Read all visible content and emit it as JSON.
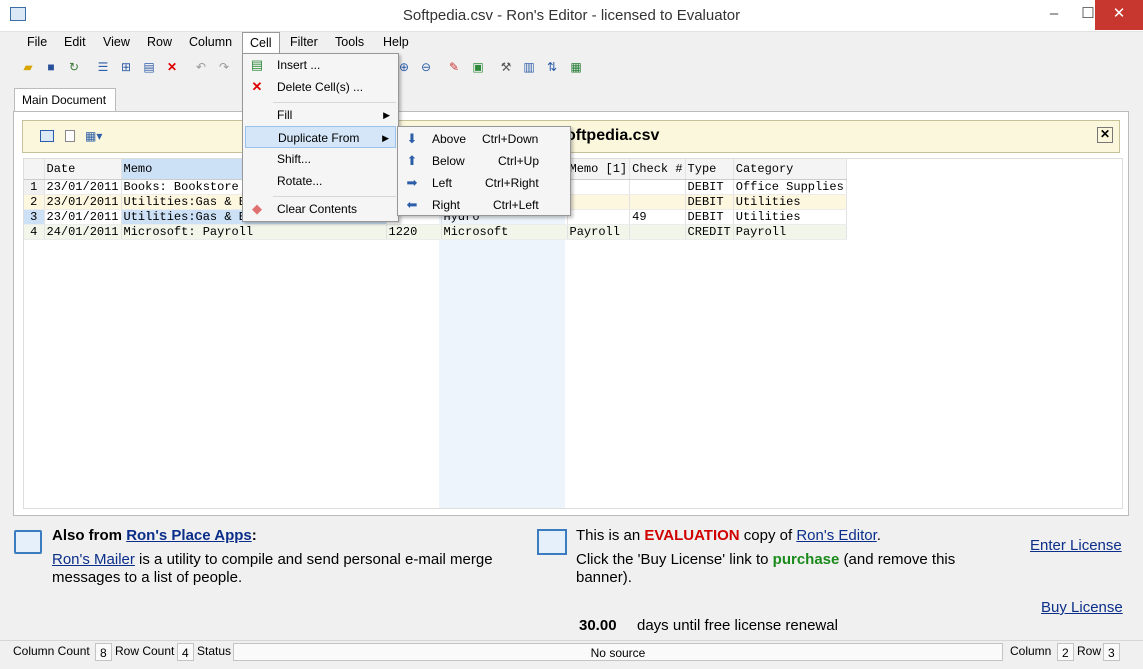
{
  "window": {
    "title": "Softpedia.csv - Ron's Editor - licensed to Evaluator",
    "minimize": "–",
    "maximize": "☐",
    "close": "✕"
  },
  "menubar": [
    "File",
    "Edit",
    "View",
    "Row",
    "Column",
    "Cell",
    "Filter",
    "Tools",
    "Help"
  ],
  "tab": {
    "label": "Main Document"
  },
  "document": {
    "title": "oftpedia.csv",
    "close": "✕"
  },
  "grid": {
    "headers": [
      "Date",
      "Memo",
      "",
      "",
      "Memo [1]",
      "Check #",
      "Type",
      "Category"
    ],
    "rows": [
      {
        "n": "1",
        "cells": [
          "23/01/2011",
          "Books: Bookstore I",
          "",
          "",
          "",
          "",
          "DEBIT",
          "Office Supplies"
        ]
      },
      {
        "n": "2",
        "cells": [
          "23/01/2011",
          "Utilities:Gas & El",
          "",
          "",
          "",
          "",
          "DEBIT",
          "Utilities"
        ]
      },
      {
        "n": "3",
        "cells": [
          "23/01/2011",
          "Utilities:Gas & El",
          "",
          "Hydro",
          "",
          "49",
          "DEBIT",
          "Utilities"
        ]
      },
      {
        "n": "4",
        "cells": [
          "24/01/2011",
          "Microsoft: Payroll",
          "1220",
          "Microsoft",
          "Payroll",
          "",
          "CREDIT",
          "Payroll"
        ]
      }
    ]
  },
  "cell_menu": {
    "insert": "Insert ...",
    "delete": "Delete Cell(s) ...",
    "fill": "Fill",
    "duplicate": "Duplicate From",
    "shift": "Shift...",
    "rotate": "Rotate...",
    "clear": "Clear Contents"
  },
  "duplicate_submenu": [
    {
      "label": "Above",
      "shortcut": "Ctrl+Down"
    },
    {
      "label": "Below",
      "shortcut": "Ctrl+Up"
    },
    {
      "label": "Left",
      "shortcut": "Ctrl+Right"
    },
    {
      "label": "Right",
      "shortcut": "Ctrl+Left"
    }
  ],
  "banner": {
    "also_from": "Also from ",
    "apps_link": "Ron's Place Apps",
    "colon": ":",
    "mailer_link": "Ron's Mailer",
    "mailer_desc": " is a utility to compile and send personal e-mail merge messages to a list of people.",
    "eval_pre": "This is an ",
    "eval_word": "EVALUATION",
    "eval_mid": " copy of ",
    "editor_link": "Ron's Editor",
    "eval_end": ".",
    "buy_pre": "Click the 'Buy License' link to ",
    "buy_word": "purchase",
    "buy_post": " (and remove this banner).",
    "enter_license": "Enter License",
    "buy_license": "Buy License",
    "days": "30.00",
    "days_text": "days until free license renewal"
  },
  "status": {
    "col_count_label": "Column Count",
    "col_count": "8",
    "row_count_label": "Row Count",
    "row_count": "4",
    "status_label": "Status",
    "source": "No source",
    "column_label": "Column",
    "column": "2",
    "row_label": "Row",
    "row": "3"
  }
}
